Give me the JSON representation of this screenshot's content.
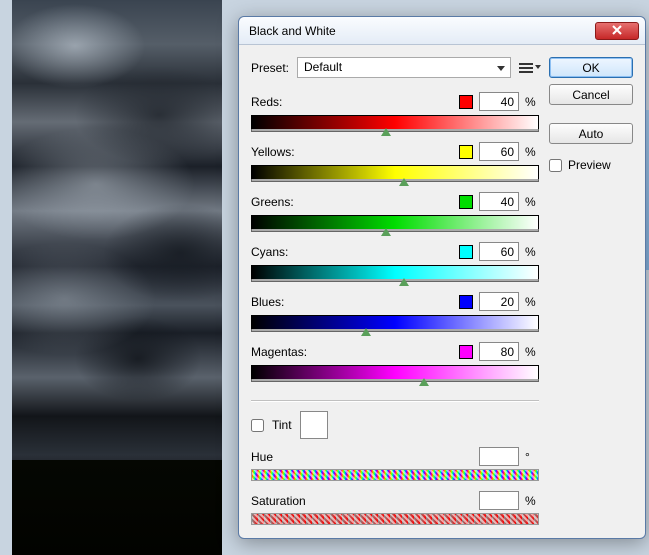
{
  "window": {
    "title": "Black and White"
  },
  "preset": {
    "label": "Preset:",
    "value": "Default"
  },
  "channels": [
    {
      "key": "reds",
      "label": "Reds:",
      "value": 40,
      "color": "#ff0000",
      "grad": "grad-red",
      "thumb_pct": 47
    },
    {
      "key": "yellows",
      "label": "Yellows:",
      "value": 60,
      "color": "#ffff00",
      "grad": "grad-yellow",
      "thumb_pct": 53
    },
    {
      "key": "greens",
      "label": "Greens:",
      "value": 40,
      "color": "#00dd00",
      "grad": "grad-green",
      "thumb_pct": 47
    },
    {
      "key": "cyans",
      "label": "Cyans:",
      "value": 60,
      "color": "#00ffff",
      "grad": "grad-cyan",
      "thumb_pct": 53
    },
    {
      "key": "blues",
      "label": "Blues:",
      "value": 20,
      "color": "#0000ff",
      "grad": "grad-blue",
      "thumb_pct": 40
    },
    {
      "key": "magentas",
      "label": "Magentas:",
      "value": 80,
      "color": "#ff00ff",
      "grad": "grad-magenta",
      "thumb_pct": 60
    }
  ],
  "unit": "%",
  "tint": {
    "label": "Tint",
    "checked": false
  },
  "hue": {
    "label": "Hue",
    "value": "",
    "unit": "°"
  },
  "saturation": {
    "label": "Saturation",
    "value": "",
    "unit": "%"
  },
  "buttons": {
    "ok": "OK",
    "cancel": "Cancel",
    "auto": "Auto"
  },
  "preview": {
    "label": "Preview",
    "checked": false
  }
}
